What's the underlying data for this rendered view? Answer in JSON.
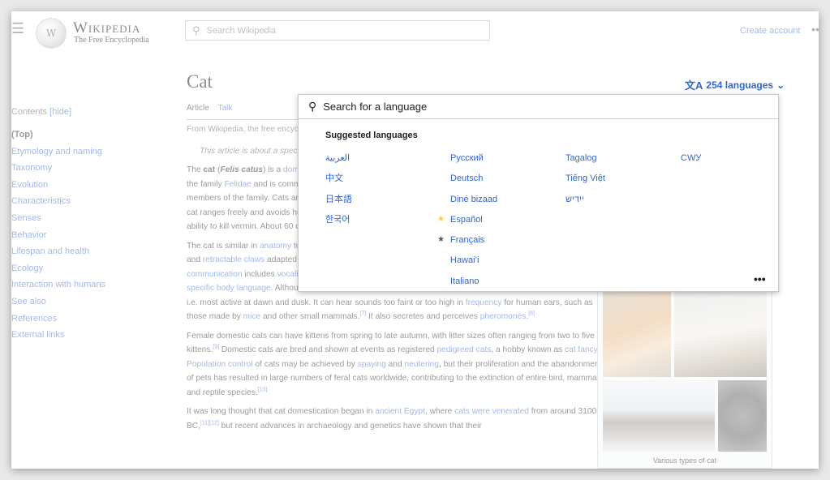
{
  "header": {
    "logo_title": "Wikipedia",
    "logo_subtitle": "The Free Encyclopedia",
    "search_placeholder": "Search Wikipedia",
    "create_account": "Create account"
  },
  "toc": {
    "heading": "Contents",
    "hide": "[hide]",
    "items": [
      "(Top)",
      "Etymology and naming",
      "Taxonomy",
      "Evolution",
      "Characteristics",
      "Senses",
      "Behavior",
      "Lifespan and health",
      "Ecology",
      "Interaction with humans",
      "See also",
      "References",
      "External links"
    ]
  },
  "article": {
    "title": "Cat",
    "tab_article": "Article",
    "tab_talk": "Talk",
    "from": "From Wikipedia, the free encyclopedia",
    "hatnote": "This article is about a species. For other uses, see Cat (disambiguation).",
    "caption": "Various types of cat"
  },
  "languages": {
    "button_label": "254 languages",
    "search_placeholder": "Search for a language",
    "suggested_title": "Suggested languages",
    "col1": [
      "العربية",
      "中文",
      "日本語",
      "한국어"
    ],
    "col2": [
      "Русский",
      "Deutsch",
      "Diné bizaad",
      "Español",
      "Français",
      "Hawaiʻi",
      "Italiano"
    ],
    "col3": [
      "Tagalog",
      "Tiếng Việt",
      "ייִדיש"
    ],
    "col4": [
      "СWУ"
    ],
    "more": "•••"
  }
}
